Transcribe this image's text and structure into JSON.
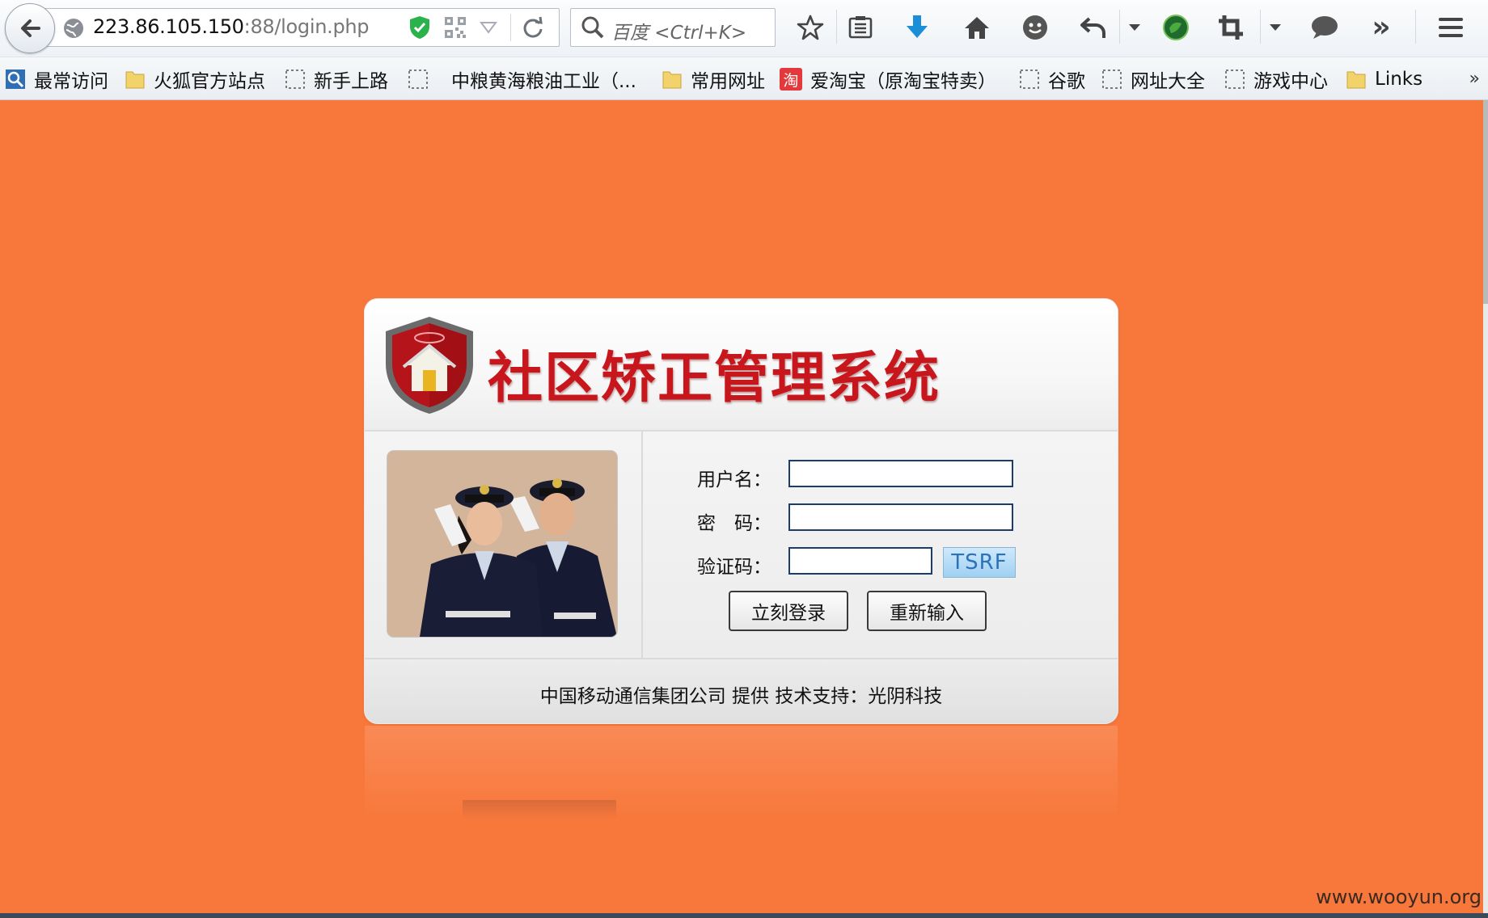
{
  "browser": {
    "url_host": "223.86.105.150",
    "url_rest": ":88/login.php",
    "search_placeholder": "百度 <Ctrl+K>",
    "bookmarks": [
      {
        "label": "最常访问",
        "icon": "search-bookmark-icon"
      },
      {
        "label": "火狐官方站点",
        "icon": "folder-icon"
      },
      {
        "label": "新手上路",
        "icon": "page-icon"
      },
      {
        "label": "中粮黄海粮油工业（...",
        "icon": "page-icon"
      },
      {
        "label": "常用网址",
        "icon": "folder-icon"
      },
      {
        "label": "爱淘宝（原淘宝特卖）",
        "icon": "taobao-icon"
      },
      {
        "label": "谷歌",
        "icon": "page-icon"
      },
      {
        "label": "网址大全",
        "icon": "page-icon"
      },
      {
        "label": "游戏中心",
        "icon": "page-icon"
      },
      {
        "label": "Links",
        "icon": "folder-icon"
      }
    ],
    "bookmarks_more": "»",
    "overflow_label": "»",
    "taobao_glyph": "淘"
  },
  "login": {
    "system_title": "社区矫正管理系统",
    "username_label": "用户名：",
    "password_label": "密　码：",
    "captcha_label": "验证码：",
    "captcha_text": "TSRF",
    "login_button": "立刻登录",
    "reset_button": "重新输入",
    "footer": "中国移动通信集团公司 提供  技术支持：光阴科技"
  },
  "watermark": "www.wooyun.org",
  "colors": {
    "page_background": "#f8773a",
    "title_red": "#c8161d",
    "input_border": "#1c3c6c"
  }
}
